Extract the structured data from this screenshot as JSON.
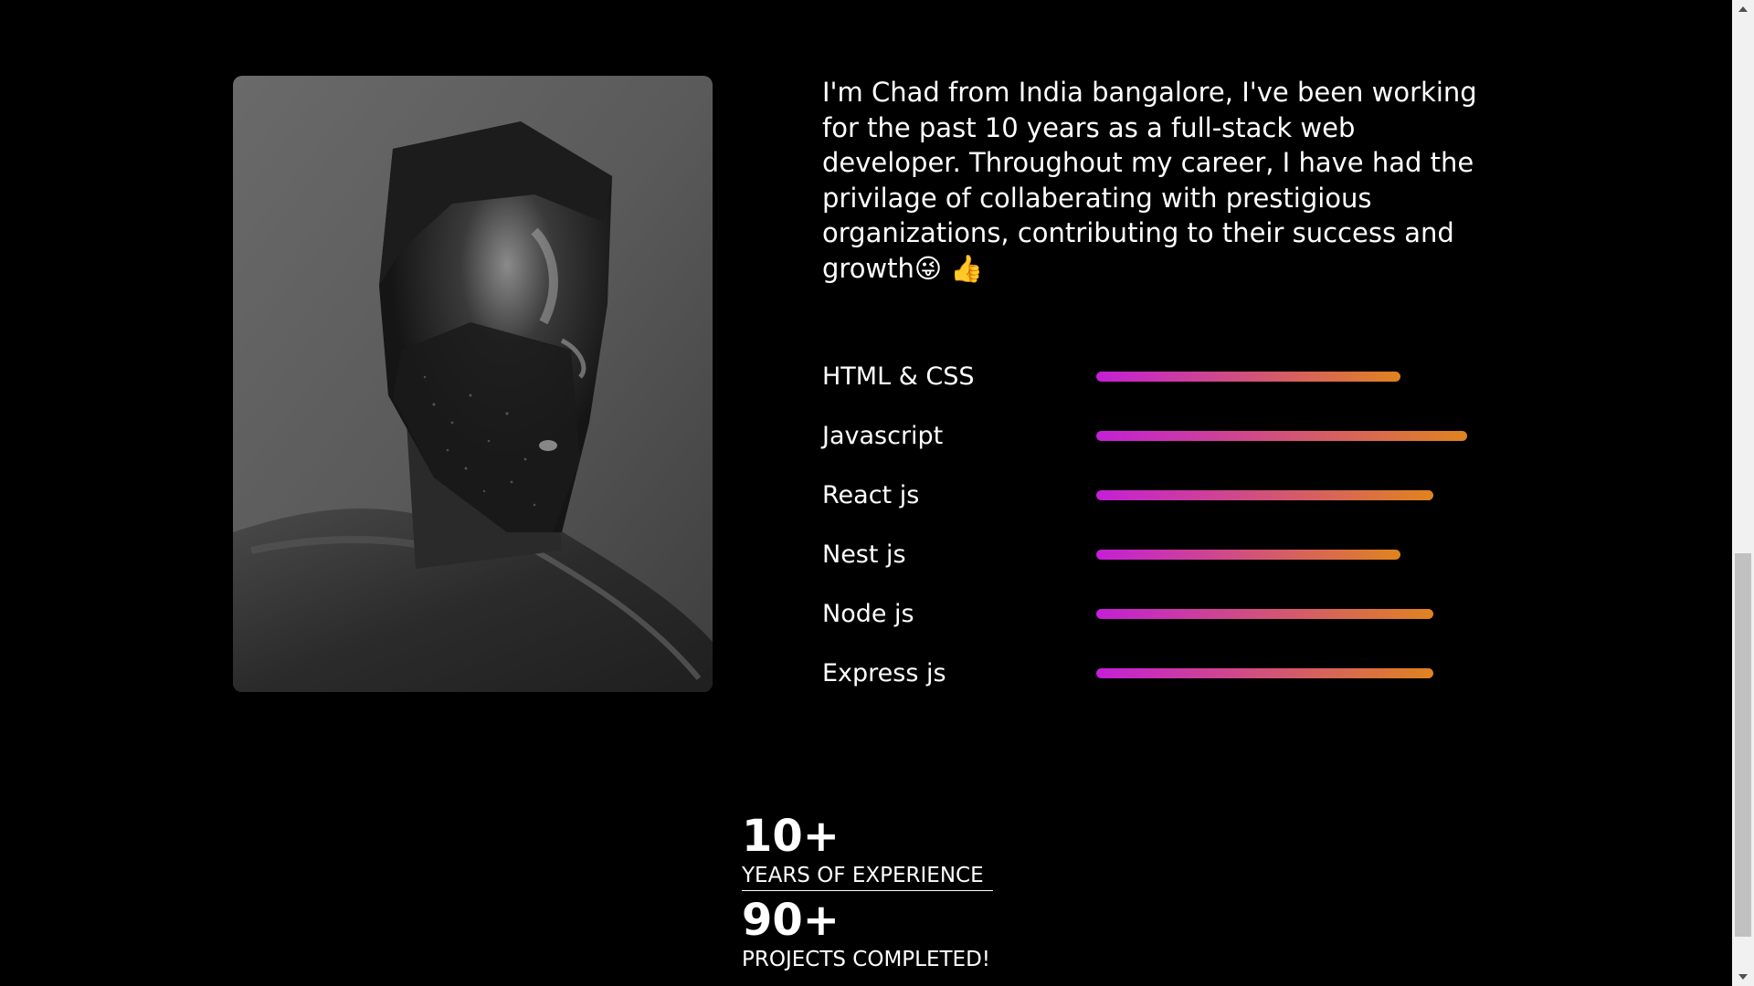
{
  "about": {
    "intro_text": "I'm Chad from India bangalore, I've been working for the past 10 years as a full-stack web developer. Throughout my career, I have had the privilage of collaberating with prestigious organizations, contributing to their success and growth",
    "emoji_1": "😜",
    "emoji_2": "👍"
  },
  "skills": [
    {
      "label": "HTML & CSS",
      "level": 0.82
    },
    {
      "label": "Javascript",
      "level": 1.0
    },
    {
      "label": "React js",
      "level": 0.91
    },
    {
      "label": "Nest js",
      "level": 0.82
    },
    {
      "label": "Node js",
      "level": 0.91
    },
    {
      "label": "Express js",
      "level": 0.91
    }
  ],
  "stats": [
    {
      "number": "10+",
      "label": "YEARS OF EXPERIENCE"
    },
    {
      "number": "90+",
      "label": "PROJECTS COMPLETED!"
    }
  ],
  "colors": {
    "background": "#000000",
    "text": "#ffffff",
    "bar_gradient_start": "#c41fd6",
    "bar_gradient_end": "#e0831f"
  },
  "icons": {
    "scroll_up": "triangle-up-icon",
    "scroll_down": "triangle-down-icon"
  }
}
